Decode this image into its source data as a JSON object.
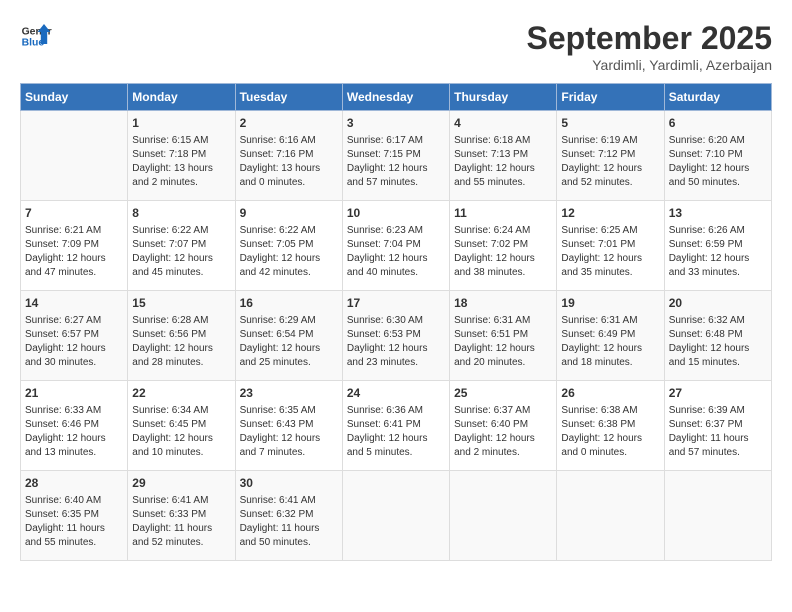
{
  "header": {
    "logo_line1": "General",
    "logo_line2": "Blue",
    "month_title": "September 2025",
    "subtitle": "Yardimli, Yardimli, Azerbaijan"
  },
  "days_of_week": [
    "Sunday",
    "Monday",
    "Tuesday",
    "Wednesday",
    "Thursday",
    "Friday",
    "Saturday"
  ],
  "weeks": [
    [
      {
        "day": "",
        "info": ""
      },
      {
        "day": "1",
        "info": "Sunrise: 6:15 AM\nSunset: 7:18 PM\nDaylight: 13 hours\nand 2 minutes."
      },
      {
        "day": "2",
        "info": "Sunrise: 6:16 AM\nSunset: 7:16 PM\nDaylight: 13 hours\nand 0 minutes."
      },
      {
        "day": "3",
        "info": "Sunrise: 6:17 AM\nSunset: 7:15 PM\nDaylight: 12 hours\nand 57 minutes."
      },
      {
        "day": "4",
        "info": "Sunrise: 6:18 AM\nSunset: 7:13 PM\nDaylight: 12 hours\nand 55 minutes."
      },
      {
        "day": "5",
        "info": "Sunrise: 6:19 AM\nSunset: 7:12 PM\nDaylight: 12 hours\nand 52 minutes."
      },
      {
        "day": "6",
        "info": "Sunrise: 6:20 AM\nSunset: 7:10 PM\nDaylight: 12 hours\nand 50 minutes."
      }
    ],
    [
      {
        "day": "7",
        "info": "Sunrise: 6:21 AM\nSunset: 7:09 PM\nDaylight: 12 hours\nand 47 minutes."
      },
      {
        "day": "8",
        "info": "Sunrise: 6:22 AM\nSunset: 7:07 PM\nDaylight: 12 hours\nand 45 minutes."
      },
      {
        "day": "9",
        "info": "Sunrise: 6:22 AM\nSunset: 7:05 PM\nDaylight: 12 hours\nand 42 minutes."
      },
      {
        "day": "10",
        "info": "Sunrise: 6:23 AM\nSunset: 7:04 PM\nDaylight: 12 hours\nand 40 minutes."
      },
      {
        "day": "11",
        "info": "Sunrise: 6:24 AM\nSunset: 7:02 PM\nDaylight: 12 hours\nand 38 minutes."
      },
      {
        "day": "12",
        "info": "Sunrise: 6:25 AM\nSunset: 7:01 PM\nDaylight: 12 hours\nand 35 minutes."
      },
      {
        "day": "13",
        "info": "Sunrise: 6:26 AM\nSunset: 6:59 PM\nDaylight: 12 hours\nand 33 minutes."
      }
    ],
    [
      {
        "day": "14",
        "info": "Sunrise: 6:27 AM\nSunset: 6:57 PM\nDaylight: 12 hours\nand 30 minutes."
      },
      {
        "day": "15",
        "info": "Sunrise: 6:28 AM\nSunset: 6:56 PM\nDaylight: 12 hours\nand 28 minutes."
      },
      {
        "day": "16",
        "info": "Sunrise: 6:29 AM\nSunset: 6:54 PM\nDaylight: 12 hours\nand 25 minutes."
      },
      {
        "day": "17",
        "info": "Sunrise: 6:30 AM\nSunset: 6:53 PM\nDaylight: 12 hours\nand 23 minutes."
      },
      {
        "day": "18",
        "info": "Sunrise: 6:31 AM\nSunset: 6:51 PM\nDaylight: 12 hours\nand 20 minutes."
      },
      {
        "day": "19",
        "info": "Sunrise: 6:31 AM\nSunset: 6:49 PM\nDaylight: 12 hours\nand 18 minutes."
      },
      {
        "day": "20",
        "info": "Sunrise: 6:32 AM\nSunset: 6:48 PM\nDaylight: 12 hours\nand 15 minutes."
      }
    ],
    [
      {
        "day": "21",
        "info": "Sunrise: 6:33 AM\nSunset: 6:46 PM\nDaylight: 12 hours\nand 13 minutes."
      },
      {
        "day": "22",
        "info": "Sunrise: 6:34 AM\nSunset: 6:45 PM\nDaylight: 12 hours\nand 10 minutes."
      },
      {
        "day": "23",
        "info": "Sunrise: 6:35 AM\nSunset: 6:43 PM\nDaylight: 12 hours\nand 7 minutes."
      },
      {
        "day": "24",
        "info": "Sunrise: 6:36 AM\nSunset: 6:41 PM\nDaylight: 12 hours\nand 5 minutes."
      },
      {
        "day": "25",
        "info": "Sunrise: 6:37 AM\nSunset: 6:40 PM\nDaylight: 12 hours\nand 2 minutes."
      },
      {
        "day": "26",
        "info": "Sunrise: 6:38 AM\nSunset: 6:38 PM\nDaylight: 12 hours\nand 0 minutes."
      },
      {
        "day": "27",
        "info": "Sunrise: 6:39 AM\nSunset: 6:37 PM\nDaylight: 11 hours\nand 57 minutes."
      }
    ],
    [
      {
        "day": "28",
        "info": "Sunrise: 6:40 AM\nSunset: 6:35 PM\nDaylight: 11 hours\nand 55 minutes."
      },
      {
        "day": "29",
        "info": "Sunrise: 6:41 AM\nSunset: 6:33 PM\nDaylight: 11 hours\nand 52 minutes."
      },
      {
        "day": "30",
        "info": "Sunrise: 6:41 AM\nSunset: 6:32 PM\nDaylight: 11 hours\nand 50 minutes."
      },
      {
        "day": "",
        "info": ""
      },
      {
        "day": "",
        "info": ""
      },
      {
        "day": "",
        "info": ""
      },
      {
        "day": "",
        "info": ""
      }
    ]
  ]
}
